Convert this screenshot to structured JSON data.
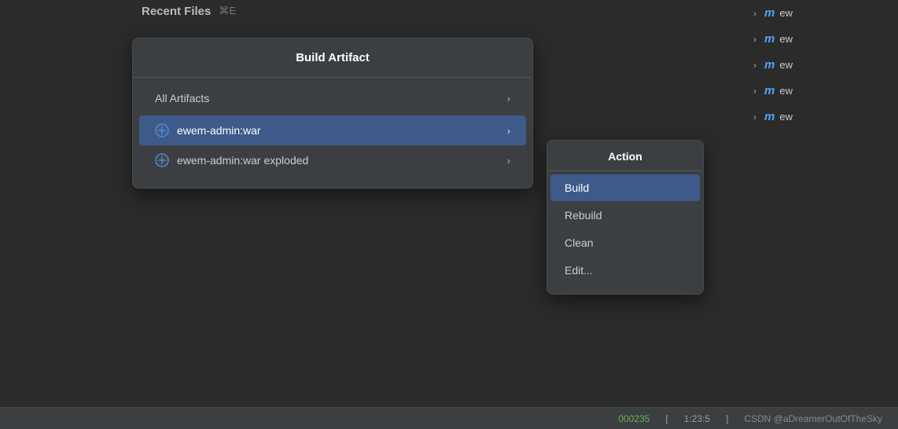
{
  "topBar": {
    "recentFiles": "Recent Files",
    "shortcut": "⌘E"
  },
  "rightSidebar": {
    "items": [
      {
        "label": "ew"
      },
      {
        "label": "ew"
      },
      {
        "label": "ew"
      },
      {
        "label": "ew"
      },
      {
        "label": "ew"
      }
    ]
  },
  "buildArtifactPanel": {
    "title": "Build Artifact",
    "allArtifacts": "All Artifacts",
    "artifacts": [
      {
        "id": "war",
        "label": "ewem-admin:war",
        "selected": true
      },
      {
        "id": "war-exploded",
        "label": "ewem-admin:war exploded",
        "selected": false
      }
    ]
  },
  "actionPanel": {
    "title": "Action",
    "items": [
      {
        "id": "build",
        "label": "Build",
        "selected": true
      },
      {
        "id": "rebuild",
        "label": "Rebuild",
        "selected": false
      },
      {
        "id": "clean",
        "label": "Clean",
        "selected": false
      },
      {
        "id": "edit",
        "label": "Edit...",
        "selected": false
      }
    ]
  },
  "statusBar": {
    "numbers": "000235",
    "coords": "1:23:5",
    "watermark": "CSDN @aDreamerOutOfTheSky"
  }
}
